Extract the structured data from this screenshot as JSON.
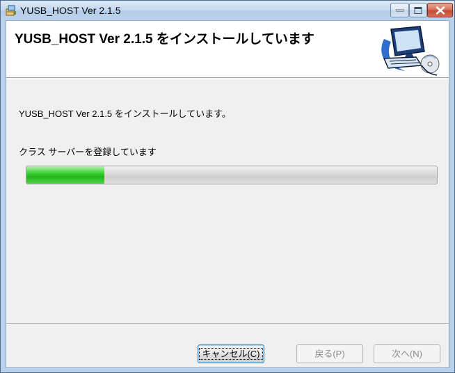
{
  "window": {
    "title": "YUSB_HOST Ver 2.1.5",
    "controls": {
      "minimize": "minimize",
      "maximize": "maximize",
      "close": "close"
    }
  },
  "banner": {
    "title": "YUSB_HOST Ver 2.1.5 をインストールしています",
    "art_icon": "computer-cd-icon"
  },
  "main": {
    "status_text": "YUSB_HOST Ver 2.1.5 をインストールしています。",
    "action_text": "クラス サーバーを登録しています",
    "progress_fraction": 0.19
  },
  "footer": {
    "cancel_label": "キャンセル(C)",
    "back_label": "戻る(P)",
    "next_label": "次へ(N)"
  },
  "colors": {
    "titlebar": "#c6daf0",
    "close_button": "#c24d33",
    "progress_green": "#1fb71a",
    "client_bg": "#f0f0f0"
  }
}
